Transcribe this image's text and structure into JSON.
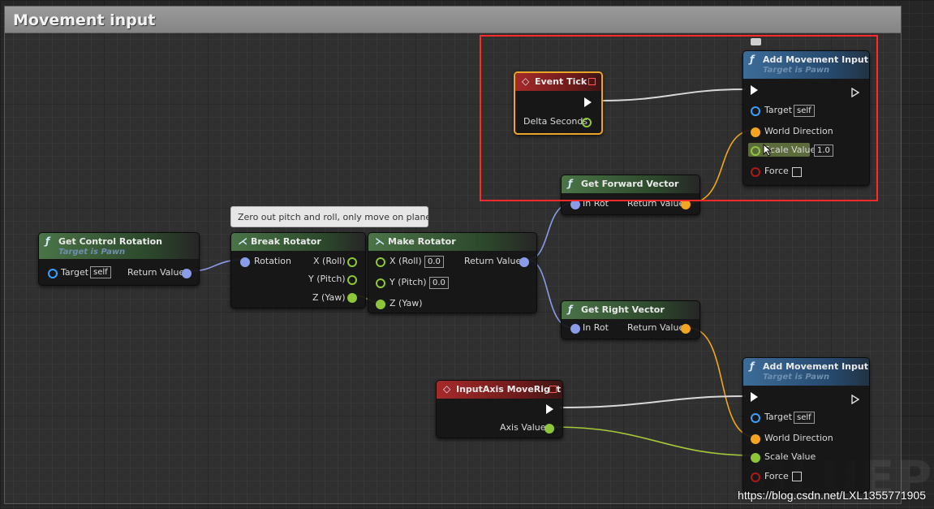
{
  "comment": {
    "title": "Movement input"
  },
  "tooltip": {
    "text": "Zero out pitch and roll, only move on plane"
  },
  "nodes": {
    "event_tick": {
      "title": "Event Tick",
      "pin_delta": "Delta Seconds"
    },
    "add_move_top": {
      "title": "Add Movement Input",
      "subtitle": "Target is Pawn",
      "target": "Target",
      "target_default": "self",
      "world_direction": "World Direction",
      "scale_value": "Scale Value",
      "scale_default": "1.0",
      "force": "Force"
    },
    "get_forward": {
      "title": "Get Forward Vector",
      "in_rot": "In Rot",
      "return_value": "Return Value"
    },
    "get_control_rotation": {
      "title": "Get Control Rotation",
      "subtitle": "Target is Pawn",
      "target": "Target",
      "target_default": "self",
      "return_value": "Return Value"
    },
    "break_rotator": {
      "title": "Break Rotator",
      "rotation": "Rotation",
      "x": "X (Roll)",
      "y": "Y (Pitch)",
      "z": "Z (Yaw)"
    },
    "make_rotator": {
      "title": "Make Rotator",
      "x": "X (Roll)",
      "x_default": "0.0",
      "y": "Y (Pitch)",
      "y_default": "0.0",
      "z": "Z (Yaw)",
      "return_value": "Return Value"
    },
    "get_right": {
      "title": "Get Right Vector",
      "in_rot": "In Rot",
      "return_value": "Return Value"
    },
    "input_axis": {
      "title": "InputAxis MoveRight",
      "axis_value": "Axis Value"
    },
    "add_move_bottom": {
      "title": "Add Movement Input",
      "subtitle": "Target is Pawn",
      "target": "Target",
      "target_default": "self",
      "world_direction": "World Direction",
      "scale_value": "Scale Value",
      "force": "Force"
    }
  },
  "watermark": {
    "url": "https://blog.csdn.net/LXL1355771905",
    "bg_text": "BLUEPRI"
  },
  "colors": {
    "highlight": "#ff2a2a",
    "exec_wire": "#d8d8d8",
    "vector_wire": "#f2a51e",
    "float_wire": "#a6c83a",
    "rotator_wire": "#8a9ce8"
  }
}
